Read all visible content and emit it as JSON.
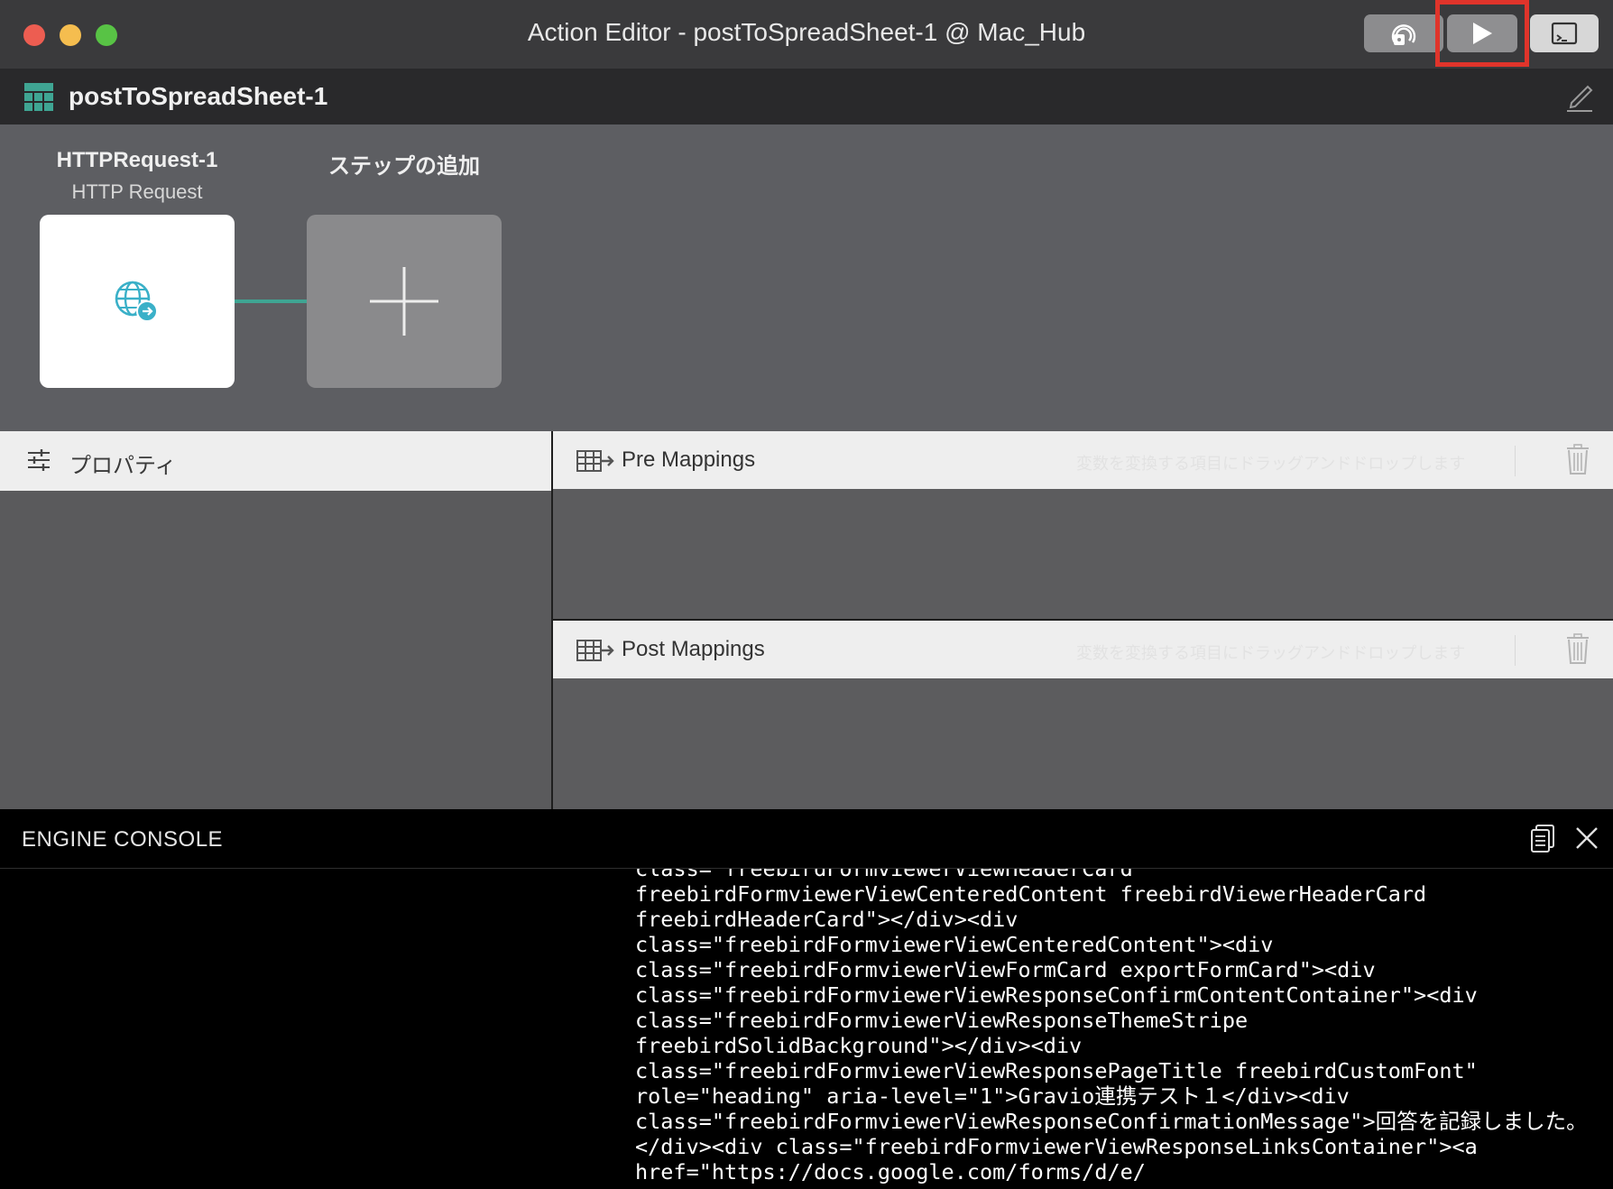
{
  "window": {
    "title": "Action Editor - postToSpreadSheet-1 @ Mac_Hub",
    "toolbar": {
      "button1_icon": "broadcast-tag-icon",
      "run_icon": "play-icon",
      "console_icon": "terminal-icon",
      "highlight_color": "#e0342b"
    }
  },
  "action": {
    "name": "postToSpreadSheet-1",
    "icon": "action-grid-icon",
    "accent": "#3fa593"
  },
  "steps": [
    {
      "title": "HTTPRequest-1",
      "subtitle": "HTTP Request",
      "icon": "globe-arrow-icon"
    },
    {
      "title": "ステップの追加",
      "icon": "plus-icon"
    }
  ],
  "properties": {
    "label": "プロパティ",
    "icon": "sliders-icon"
  },
  "mappings": {
    "pre": {
      "label": "Pre Mappings",
      "hint": "変数を変換する項目にドラッグアンドドロップします"
    },
    "post": {
      "label": "Post Mappings",
      "hint": "変数を変換する項目にドラッグアンドドロップします"
    }
  },
  "console": {
    "title": "ENGINE CONSOLE",
    "lines": [
      "class=\"freebirdFormviewerViewHeaderCard",
      "freebirdFormviewerViewCenteredContent freebirdViewerHeaderCard",
      "freebirdHeaderCard\"></div><div",
      "class=\"freebirdFormviewerViewCenteredContent\"><div",
      "class=\"freebirdFormviewerViewFormCard exportFormCard\"><div",
      "class=\"freebirdFormviewerViewResponseConfirmContentContainer\"><div",
      "class=\"freebirdFormviewerViewResponseThemeStripe",
      "freebirdSolidBackground\"></div><div",
      "class=\"freebirdFormviewerViewResponsePageTitle freebirdCustomFont\"",
      "role=\"heading\" aria-level=\"1\">Gravio連携テスト１</div><div",
      "class=\"freebirdFormviewerViewResponseConfirmationMessage\">回答を記録しました。",
      "</div><div class=\"freebirdFormviewerViewResponseLinksContainer\"><a",
      "href=\"https://docs.google.com/forms/d/e/"
    ]
  }
}
